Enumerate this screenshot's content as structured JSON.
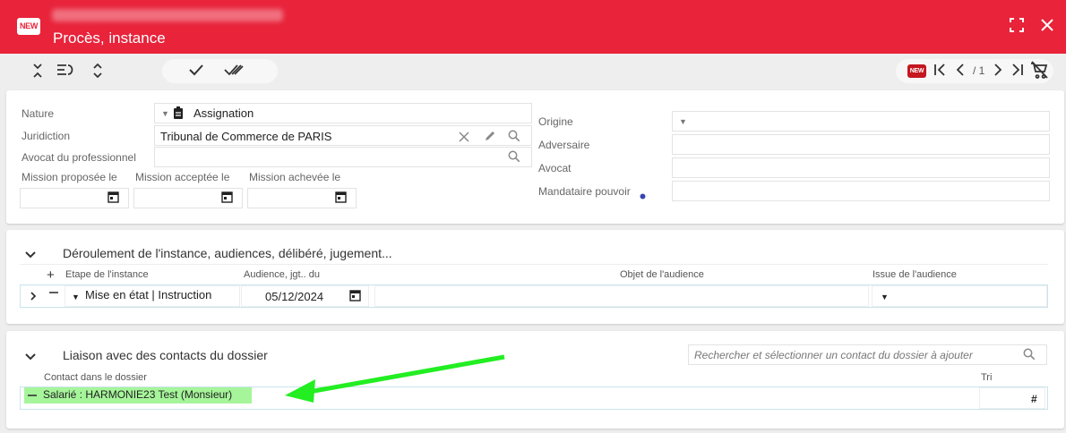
{
  "header": {
    "badge": "NEW",
    "title": "Procès, instance",
    "icons": {
      "maximize": "fullscreen-icon",
      "close": "close-icon"
    }
  },
  "toolbar": {
    "pager_badge": "NEW",
    "pager_text": "/ 1",
    "icons": [
      "collapse-icon",
      "expand-toggle-icon",
      "sort-icon",
      "check-icon",
      "double-check-icon",
      "first-page-icon",
      "previous-page-icon",
      "next-page-icon",
      "last-page-icon",
      "cart-off-icon"
    ]
  },
  "form": {
    "nature": {
      "label": "Nature",
      "value": "Assignation"
    },
    "juridiction": {
      "label": "Juridiction",
      "value": "Tribunal de Commerce de PARIS"
    },
    "avocat_pro": {
      "label": "Avocat du professionnel",
      "value": ""
    },
    "mission_proposee": {
      "label": "Mission proposée le",
      "value": ""
    },
    "mission_acceptee": {
      "label": "Mission acceptée le",
      "value": ""
    },
    "mission_achevee": {
      "label": "Mission achevée le",
      "value": ""
    },
    "origine": {
      "label": "Origine",
      "value": ""
    },
    "adversaire": {
      "label": "Adversaire",
      "value": ""
    },
    "avocat": {
      "label": "Avocat",
      "value": ""
    },
    "mandataire": {
      "label": "Mandataire pouvoir",
      "value": ""
    }
  },
  "deroulement": {
    "title": "Déroulement de l'instance, audiences, délibéré, jugement...",
    "columns": [
      "Etape de l'instance",
      "Audience, jgt.. du",
      "Objet de l'audience",
      "Issue de l'audience"
    ],
    "row": {
      "etape": "Mise en état | Instruction",
      "date": "05/12/2024",
      "objet": "",
      "issue": ""
    }
  },
  "liaison": {
    "title": "Liaison avec des contacts du dossier",
    "search_placeholder": "Rechercher et sélectionner un contact du dossier à ajouter",
    "columns": [
      "Contact dans le dossier",
      "Tri"
    ],
    "row": {
      "contact": "Salarié : HARMONIE23 Test (Monsieur)",
      "tri": "#"
    },
    "highlight_color": "#a6f59a",
    "arrow_color": "#22ee22"
  },
  "colors": {
    "header": "#e8233a",
    "accent_border": "#c9e4ec"
  }
}
